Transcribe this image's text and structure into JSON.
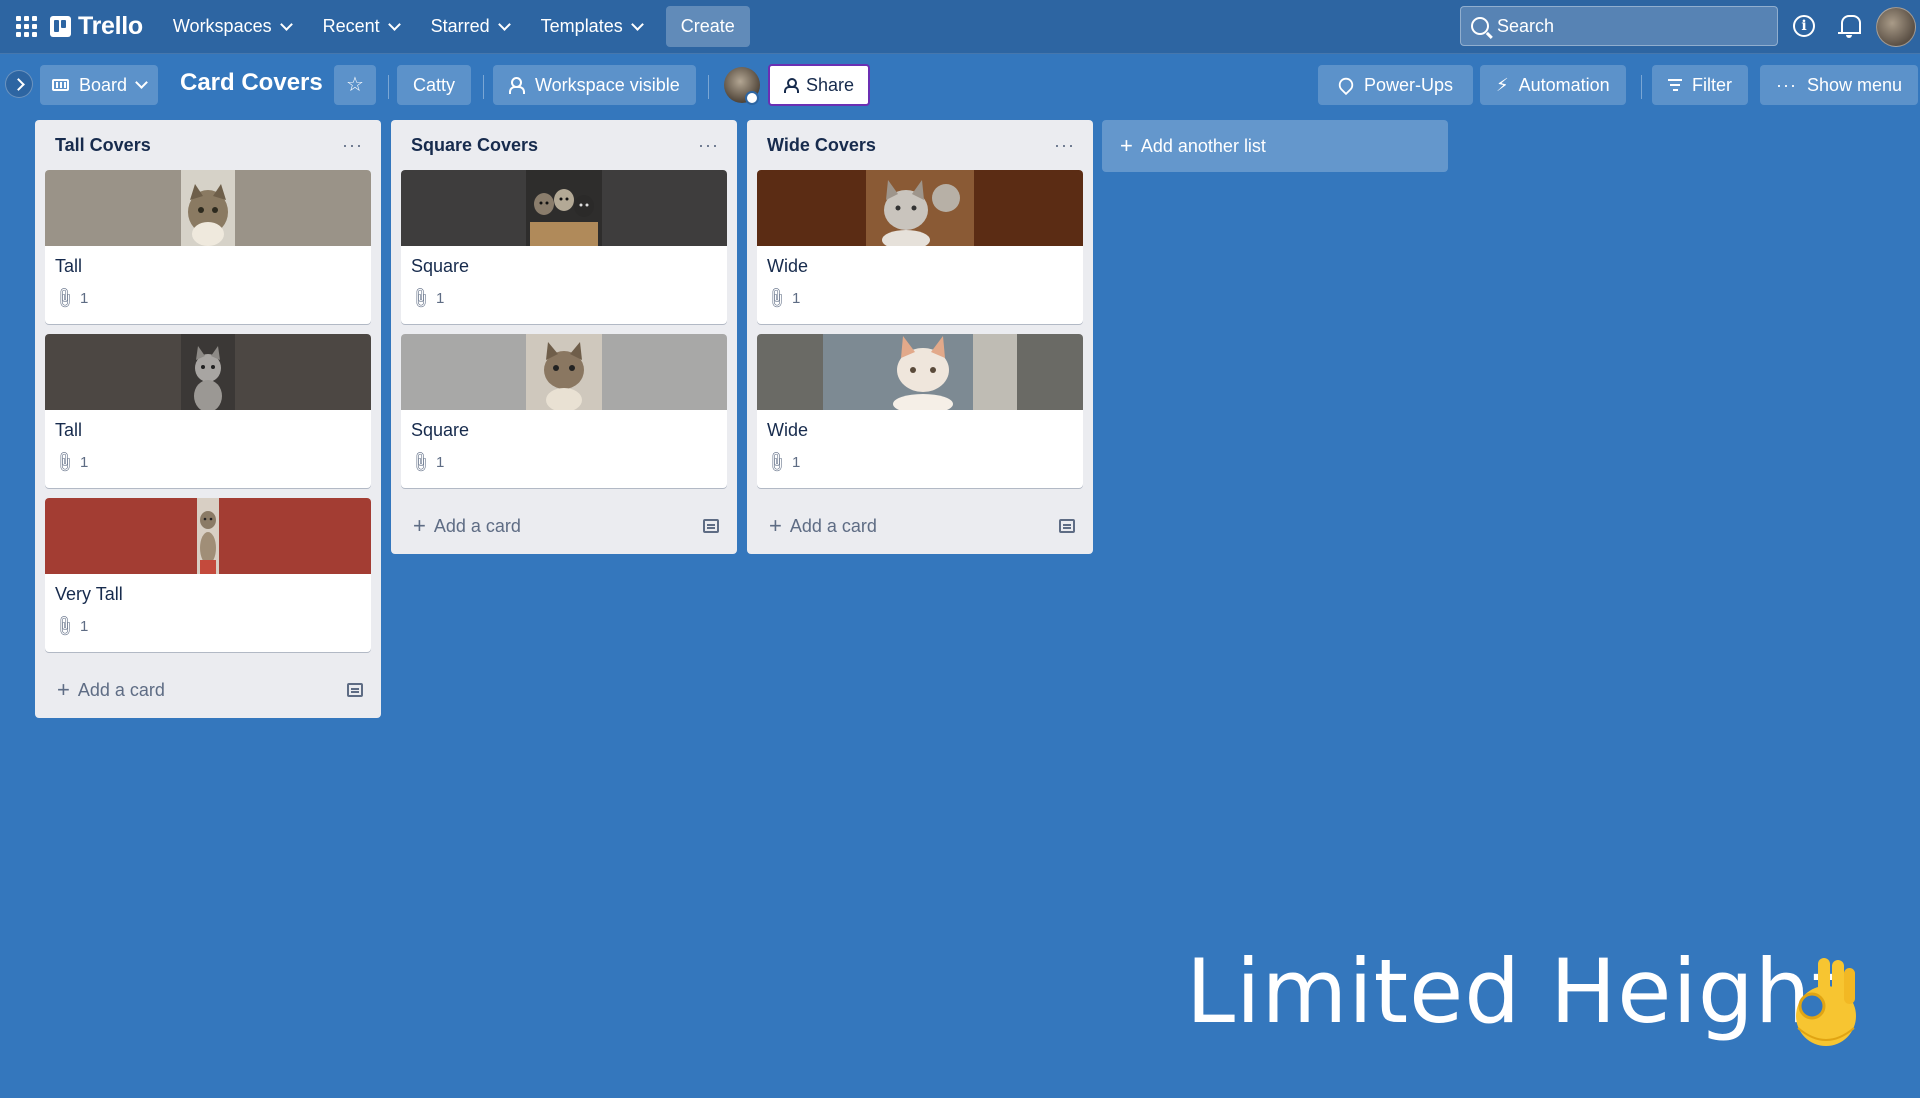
{
  "nav": {
    "brand": "Trello",
    "items": [
      {
        "label": "Workspaces"
      },
      {
        "label": "Recent"
      },
      {
        "label": "Starred"
      },
      {
        "label": "Templates"
      }
    ],
    "create_label": "Create",
    "search_placeholder": "Search"
  },
  "board": {
    "view_label": "Board",
    "title": "Card Covers",
    "workspace": "Catty",
    "visibility": "Workspace visible",
    "share_label": "Share",
    "powerups_label": "Power-Ups",
    "automation_label": "Automation",
    "filter_label": "Filter",
    "show_menu_label": "Show menu"
  },
  "lists": [
    {
      "title": "Tall Covers",
      "menu": "···",
      "cards": [
        {
          "title": "Tall",
          "attachments": "1",
          "cover_color": "#9a9388",
          "cover_kind": "tall"
        },
        {
          "title": "Tall",
          "attachments": "1",
          "cover_color": "#4c4743",
          "cover_kind": "tall"
        },
        {
          "title": "Very Tall",
          "attachments": "1",
          "cover_color": "#a33d33",
          "cover_kind": "very-tall"
        }
      ],
      "add_card_label": "Add a card"
    },
    {
      "title": "Square Covers",
      "menu": "···",
      "cards": [
        {
          "title": "Square",
          "attachments": "1",
          "cover_color": "#3e3d3d",
          "cover_kind": "square"
        },
        {
          "title": "Square",
          "attachments": "1",
          "cover_color": "#a8a8a7",
          "cover_kind": "square"
        }
      ],
      "add_card_label": "Add a card"
    },
    {
      "title": "Wide Covers",
      "menu": "···",
      "cards": [
        {
          "title": "Wide",
          "attachments": "1",
          "cover_color": "#5b2c14",
          "cover_kind": "wide"
        },
        {
          "title": "Wide",
          "attachments": "1",
          "cover_color": "#6a6a65",
          "cover_kind": "wide"
        }
      ],
      "add_card_label": "Add a card"
    }
  ],
  "add_list_label": "Add another list",
  "overlay_caption": "Limited Height",
  "colors": {
    "board_bg": "#3477bd",
    "nav_bg": "#2d65a2",
    "list_bg": "#ebecf0"
  }
}
